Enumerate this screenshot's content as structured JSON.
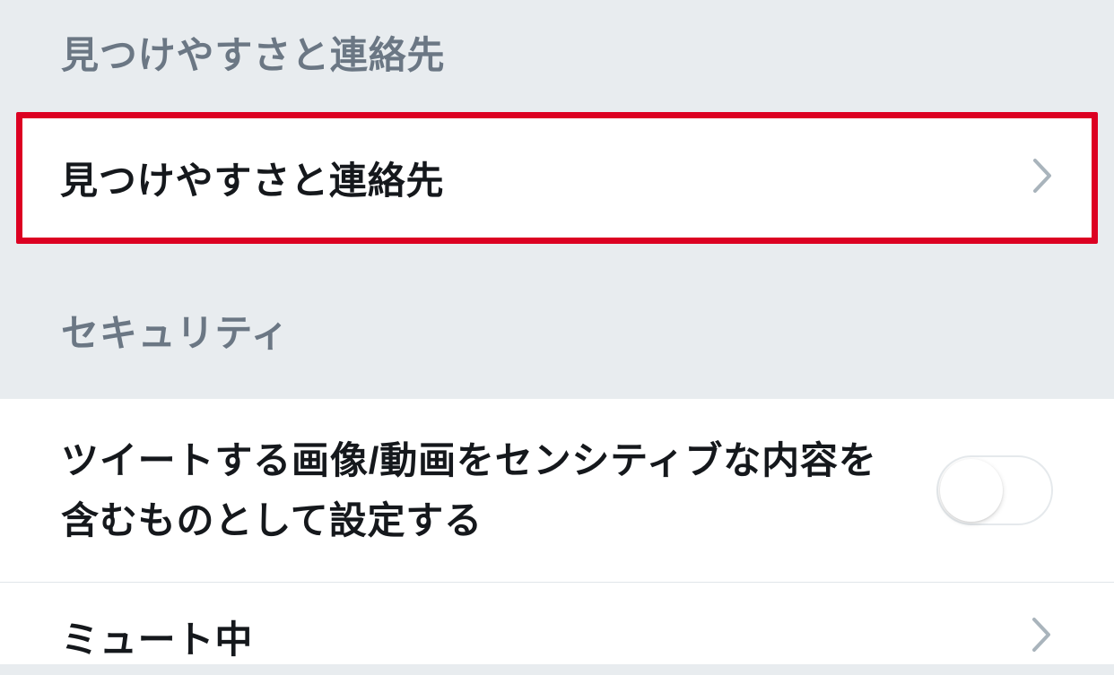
{
  "sections": {
    "discoverability": {
      "header": "見つけやすさと連絡先",
      "item_label": "見つけやすさと連絡先",
      "highlighted": true
    },
    "security": {
      "header": "セキュリティ",
      "sensitive_content_label": "ツイートする画像/動画をセンシティブな内容を含むものとして設定する",
      "sensitive_content_enabled": false,
      "muted_label": "ミュート中"
    }
  }
}
